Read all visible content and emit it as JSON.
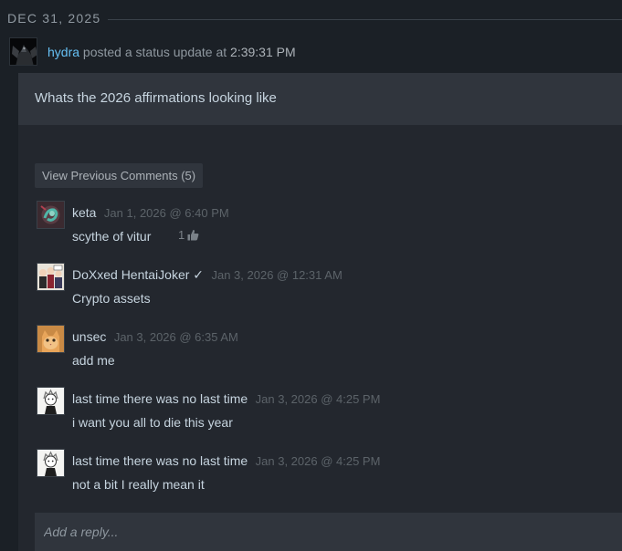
{
  "date_header": "DEC 31, 2025",
  "post": {
    "author": "hydra",
    "action": " posted a status update at ",
    "time": "2:39:31 PM",
    "status_text": "Whats the 2026 affirmations looking like"
  },
  "view_previous_label": "View Previous Comments (5)",
  "comments": [
    {
      "author": "keta",
      "timestamp": "Jan 1, 2026 @ 6:40 PM",
      "text": "scythe of vitur",
      "likes": "1",
      "avatar_icon": "teal-swirl-avatar-icon"
    },
    {
      "author": "DoXxed HentaiJoker ✓",
      "timestamp": "Jan 3, 2026 @ 12:31 AM",
      "text": "Crypto assets",
      "avatar_icon": "cartoon-group-avatar-icon"
    },
    {
      "author": "unsec",
      "timestamp": "Jan 3, 2026 @ 6:35 AM",
      "text": "add me",
      "avatar_icon": "orange-cat-avatar-icon"
    },
    {
      "author": "last time there was no last time",
      "timestamp": "Jan 3, 2026 @ 4:25 PM",
      "text": "i want you all to die this year",
      "avatar_icon": "sketch-character-avatar-icon"
    },
    {
      "author": "last time there was no last time",
      "timestamp": "Jan 3, 2026 @ 4:25 PM",
      "text": "not a bit I really mean it",
      "avatar_icon": "sketch-character-avatar-icon"
    }
  ],
  "reply": {
    "placeholder": "Add a reply..."
  },
  "colors": {
    "background": "#1b2026",
    "card": "#23272e",
    "status_box": "#30353d",
    "username_link": "#66c0f4",
    "text": "#c6d4df",
    "muted": "#5c6369"
  }
}
